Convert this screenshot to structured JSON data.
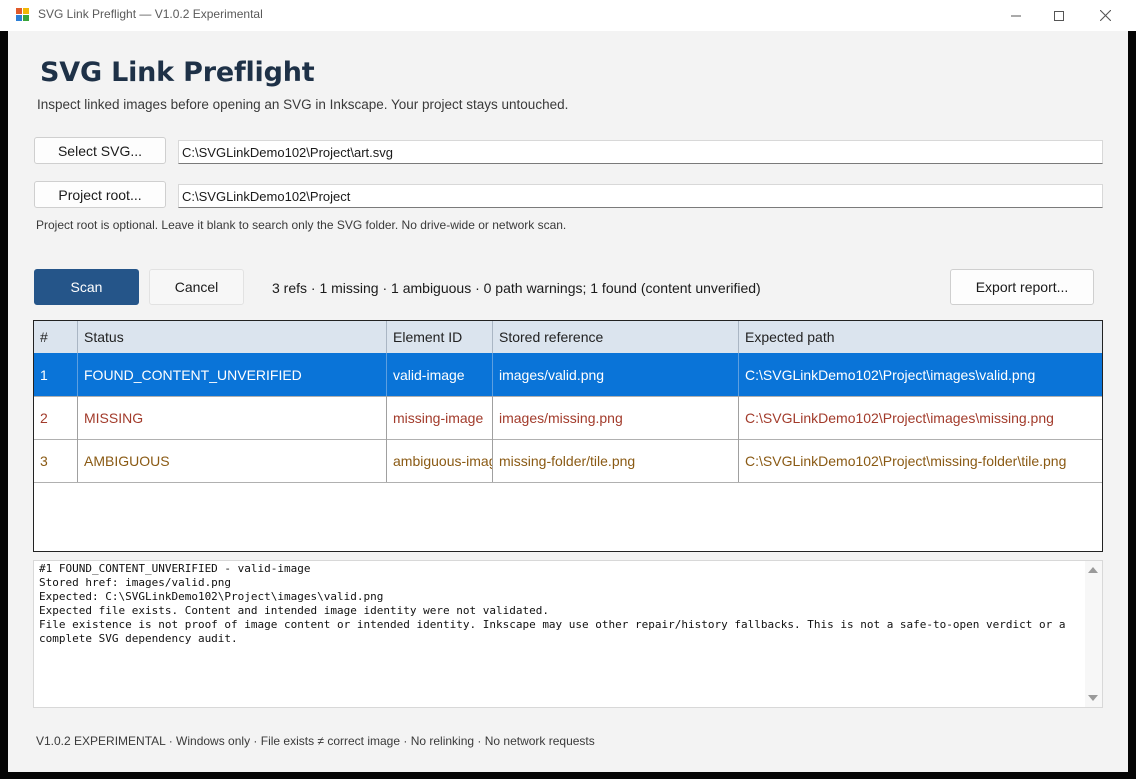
{
  "window": {
    "title": "SVG Link Preflight — V1.0.2 Experimental"
  },
  "header": {
    "title": "SVG Link Preflight",
    "subtitle": "Inspect linked images before opening an SVG in Inkscape. Your project stays untouched."
  },
  "inputs": {
    "select_svg_label": "Select SVG...",
    "svg_path": "C:\\SVGLinkDemo102\\Project\\art.svg",
    "project_root_label": "Project root...",
    "project_root_path": "C:\\SVGLinkDemo102\\Project",
    "hint": "Project root is optional. Leave it blank to search only the SVG folder. No drive-wide or network scan."
  },
  "actions": {
    "scan_label": "Scan",
    "cancel_label": "Cancel",
    "summary": "3 refs · 1 missing · 1 ambiguous · 0 path warnings; 1 found (content unverified)",
    "export_label": "Export report..."
  },
  "grid": {
    "columns": [
      "#",
      "Status",
      "Element ID",
      "Stored reference",
      "Expected path"
    ],
    "rows": [
      {
        "num": "1",
        "status": "FOUND_CONTENT_UNVERIFIED",
        "element_id": "valid-image",
        "stored": "images/valid.png",
        "expected": "C:\\SVGLinkDemo102\\Project\\images\\valid.png"
      },
      {
        "num": "2",
        "status": "MISSING",
        "element_id": "missing-image",
        "stored": "images/missing.png",
        "expected": "C:\\SVGLinkDemo102\\Project\\images\\missing.png"
      },
      {
        "num": "3",
        "status": "AMBIGUOUS",
        "element_id": "ambiguous-image",
        "stored": "missing-folder/tile.png",
        "expected": "C:\\SVGLinkDemo102\\Project\\missing-folder\\tile.png"
      }
    ]
  },
  "details": {
    "text": "#1 FOUND_CONTENT_UNVERIFIED - valid-image\nStored href: images/valid.png\nExpected: C:\\SVGLinkDemo102\\Project\\images\\valid.png\nExpected file exists. Content and intended image identity were not validated.\nFile existence is not proof of image content or intended identity. Inkscape may use other repair/history fallbacks. This is not a safe-to-open verdict or a complete SVG dependency audit."
  },
  "footer": {
    "text": "V1.0.2 EXPERIMENTAL · Windows only · File exists ≠ correct image · No relinking · No network requests"
  },
  "colors": {
    "primary": "#255589",
    "selected_row": "#0a74d8",
    "missing": "#a23b2b",
    "ambiguous": "#8a5a14",
    "header_bg": "#dbe4ee"
  }
}
